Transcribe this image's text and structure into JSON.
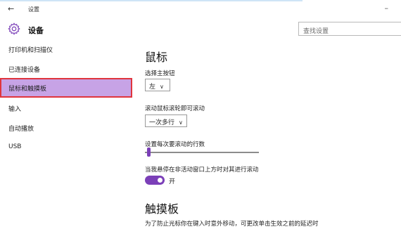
{
  "window": {
    "title": "设置",
    "back_glyph": "←",
    "minimize_glyph": "–"
  },
  "header": {
    "title": "设备",
    "search_placeholder": "查找设置"
  },
  "sidebar": {
    "items": [
      {
        "label": "打印机和扫描仪"
      },
      {
        "label": "已连接设备"
      },
      {
        "label": "鼠标和触摸板"
      },
      {
        "label": "输入"
      },
      {
        "label": "自动播放"
      },
      {
        "label": "USB"
      }
    ],
    "selected_index": 2
  },
  "main": {
    "mouse_heading": "鼠标",
    "primary_button": {
      "label": "选择主按钮",
      "value": "左"
    },
    "scroll_mode": {
      "label": "滚动鼠标滚轮即可滚动",
      "value": "一次多行"
    },
    "lines_to_scroll": {
      "label": "设置每次要滚动的行数",
      "level_fraction": 0.02
    },
    "inactive_scroll": {
      "label": "当我悬停在非活动窗口上方时对其进行滚动",
      "state_label": "开",
      "on": true
    },
    "touchpad_heading": "触摸板",
    "touchpad_desc": "为了防止光标你在键入时意外移动，可更改单击生效之前的延迟时"
  },
  "colors": {
    "accent": "#7b3fb8",
    "selected_background": "#c7a3e6",
    "highlight_border": "#e0353d"
  }
}
